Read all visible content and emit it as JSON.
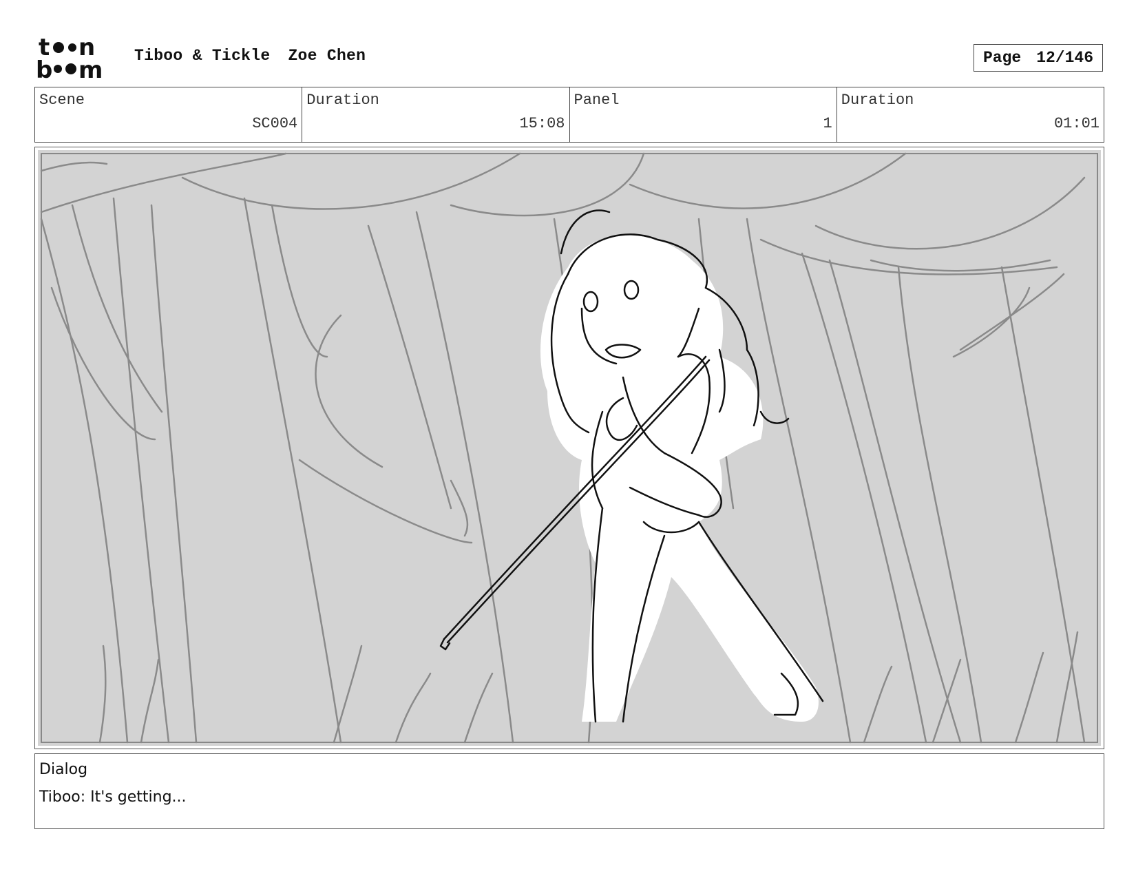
{
  "header": {
    "logo_text_top": "toon",
    "logo_text_bottom": "boom",
    "project": "Tiboo & Tickle",
    "author": "Zoe Chen",
    "page_label": "Page",
    "page_value": "12/146"
  },
  "info": {
    "scene_label": "Scene",
    "scene_value": "SC004",
    "scene_duration_label": "Duration",
    "scene_duration_value": "15:08",
    "panel_label": "Panel",
    "panel_value": "1",
    "panel_duration_label": "Duration",
    "panel_duration_value": "01:01"
  },
  "panel": {
    "image_subject": "storyboard-sketch-girl-in-forest",
    "background_color": "#d3d3d3"
  },
  "dialog": {
    "label": "Dialog",
    "text": "Tiboo: It's getting..."
  }
}
